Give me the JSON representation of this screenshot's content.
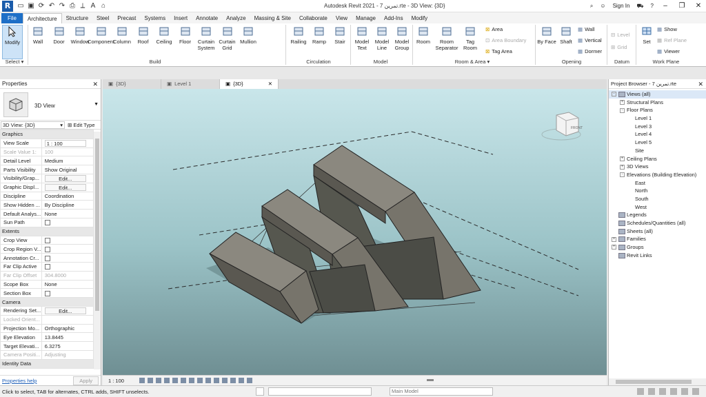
{
  "title_bar": {
    "app_logo": "R",
    "title": "Autodesk Revit 2021 - 7 تمرين.rte - 3D View: {3D}",
    "sign_in": "Sign In",
    "minimize": "–",
    "restore": "❐",
    "close": "✕"
  },
  "ribbon_tabs": [
    "File",
    "Architecture",
    "Structure",
    "Steel",
    "Precast",
    "Systems",
    "Insert",
    "Annotate",
    "Analyze",
    "Massing & Site",
    "Collaborate",
    "View",
    "Manage",
    "Add-Ins",
    "Modify"
  ],
  "ribbon": {
    "modify": "Modify",
    "select_label": "Select",
    "build_tools": [
      "Wall",
      "Door",
      "Window",
      "Component",
      "Column",
      "Roof",
      "Ceiling",
      "Floor",
      "Curtain System",
      "Curtain Grid",
      "Mullion"
    ],
    "build_label": "Build",
    "circulation_tools": [
      "Railing",
      "Ramp",
      "Stair"
    ],
    "circulation_label": "Circulation",
    "model_tools": [
      "Model Text",
      "Model Line",
      "Model Group"
    ],
    "model_label": "Model",
    "room_tools": [
      "Room",
      "Room Separator",
      "Tag Room"
    ],
    "room_small": [
      "Area",
      "Area Boundary",
      "Tag Area"
    ],
    "room_label": "Room & Area",
    "opening_tools": [
      "By Face",
      "Shaft"
    ],
    "opening_small": [
      "Wall",
      "Vertical",
      "Dormer"
    ],
    "opening_label": "Opening",
    "datum_small": [
      "Level",
      "Grid"
    ],
    "datum_label": "Datum",
    "workplane_tool": "Set",
    "workplane_small": [
      "Show",
      "Ref Plane",
      "Viewer"
    ],
    "workplane_label": "Work Plane"
  },
  "properties": {
    "header": "Properties",
    "type_name": "3D View",
    "selector": "3D View: {3D}",
    "edit_type": "Edit Type",
    "rows": [
      {
        "group": "Graphics"
      },
      {
        "k": "View Scale",
        "v": "1 : 100",
        "kind": "input"
      },
      {
        "k": "Scale Value 1:",
        "v": "100",
        "dim": true
      },
      {
        "k": "Detail Level",
        "v": "Medium"
      },
      {
        "k": "Parts Visibility",
        "v": "Show Original"
      },
      {
        "k": "Visibility/Grap...",
        "v": "Edit...",
        "kind": "button"
      },
      {
        "k": "Graphic Displ...",
        "v": "Edit...",
        "kind": "button"
      },
      {
        "k": "Discipline",
        "v": "Coordination"
      },
      {
        "k": "Show Hidden ...",
        "v": "By Discipline"
      },
      {
        "k": "Default Analys...",
        "v": "None"
      },
      {
        "k": "Sun Path",
        "kind": "check"
      },
      {
        "group": "Extents"
      },
      {
        "k": "Crop View",
        "kind": "check"
      },
      {
        "k": "Crop Region V...",
        "kind": "check"
      },
      {
        "k": "Annotation Cr...",
        "kind": "check"
      },
      {
        "k": "Far Clip Active",
        "kind": "check"
      },
      {
        "k": "Far Clip Offset",
        "v": "304.8000",
        "dim": true
      },
      {
        "k": "Scope Box",
        "v": "None"
      },
      {
        "k": "Section Box",
        "kind": "check"
      },
      {
        "group": "Camera"
      },
      {
        "k": "Rendering Set...",
        "v": "Edit...",
        "kind": "button"
      },
      {
        "k": "Locked Orient...",
        "dim": true
      },
      {
        "k": "Projection Mo...",
        "v": "Orthographic"
      },
      {
        "k": "Eye Elevation",
        "v": "13.8445"
      },
      {
        "k": "Target Elevati...",
        "v": "6.3275"
      },
      {
        "k": "Camera Positi...",
        "v": "Adjusting",
        "dim": true
      },
      {
        "group": "Identity Data"
      }
    ],
    "help": "Properties help",
    "apply": "Apply"
  },
  "view_tabs": [
    {
      "label": "{3D}",
      "active": false
    },
    {
      "label": "Level 1",
      "active": false
    },
    {
      "label": "{3D}",
      "active": true
    }
  ],
  "view_close": "✕",
  "viewcube_label": "FRONT",
  "view_bar": {
    "scale": "1 : 100"
  },
  "project_browser": {
    "header": "Project Browser - 7 تمرين.rte",
    "nodes": [
      {
        "label": "Views (all)",
        "indent": 0,
        "exp": "-",
        "icon": true,
        "sel": true
      },
      {
        "label": "Structural Plans",
        "indent": 1,
        "exp": "+"
      },
      {
        "label": "Floor Plans",
        "indent": 1,
        "exp": "-"
      },
      {
        "label": "Level 1",
        "indent": 2
      },
      {
        "label": "Level 3",
        "indent": 2
      },
      {
        "label": "Level 4",
        "indent": 2
      },
      {
        "label": "Level 5",
        "indent": 2
      },
      {
        "label": "Site",
        "indent": 2
      },
      {
        "label": "Ceiling Plans",
        "indent": 1,
        "exp": "+"
      },
      {
        "label": "3D Views",
        "indent": 1,
        "exp": "+"
      },
      {
        "label": "Elevations (Building Elevation)",
        "indent": 1,
        "exp": "-"
      },
      {
        "label": "East",
        "indent": 2
      },
      {
        "label": "North",
        "indent": 2
      },
      {
        "label": "South",
        "indent": 2
      },
      {
        "label": "West",
        "indent": 2
      },
      {
        "label": "Legends",
        "indent": 0,
        "icon": true
      },
      {
        "label": "Schedules/Quantities (all)",
        "indent": 0,
        "icon": true
      },
      {
        "label": "Sheets (all)",
        "indent": 0,
        "icon": true
      },
      {
        "label": "Families",
        "indent": 0,
        "exp": "+",
        "icon": true
      },
      {
        "label": "Groups",
        "indent": 0,
        "exp": "+",
        "icon": true
      },
      {
        "label": "Revit Links",
        "indent": 0,
        "icon": true
      }
    ]
  },
  "status_bar": {
    "message": "Click to select, TAB for alternates, CTRL adds, SHIFT unselects.",
    "model": "Main Model"
  },
  "colors": {
    "file_tab": "#1e6fc7",
    "solid": "#77746b",
    "solid_dark": "#5a5851",
    "solid_light": "#8b887f"
  }
}
